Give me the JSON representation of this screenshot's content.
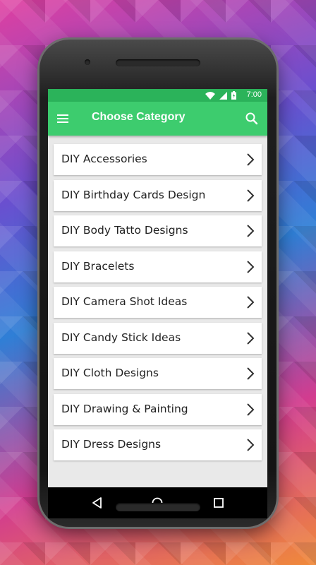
{
  "status_bar": {
    "time": "7:00",
    "icons": [
      "wifi-icon",
      "signal-icon",
      "battery-icon"
    ]
  },
  "app_bar": {
    "title": "Choose Category",
    "left_icon": "menu-icon",
    "right_icon": "search-icon",
    "color": "#3dcc6e"
  },
  "categories": [
    {
      "label": "DIY Accessories"
    },
    {
      "label": "DIY Birthday Cards Design"
    },
    {
      "label": "DIY Body Tatto Designs"
    },
    {
      "label": "DIY Bracelets"
    },
    {
      "label": "DIY Camera Shot Ideas"
    },
    {
      "label": "DIY Candy Stick Ideas"
    },
    {
      "label": "DIY Cloth Designs"
    },
    {
      "label": "DIY Drawing & Painting"
    },
    {
      "label": "DIY Dress Designs"
    }
  ],
  "nav_bar": {
    "buttons": [
      "back-icon",
      "home-icon",
      "recents-icon"
    ]
  }
}
